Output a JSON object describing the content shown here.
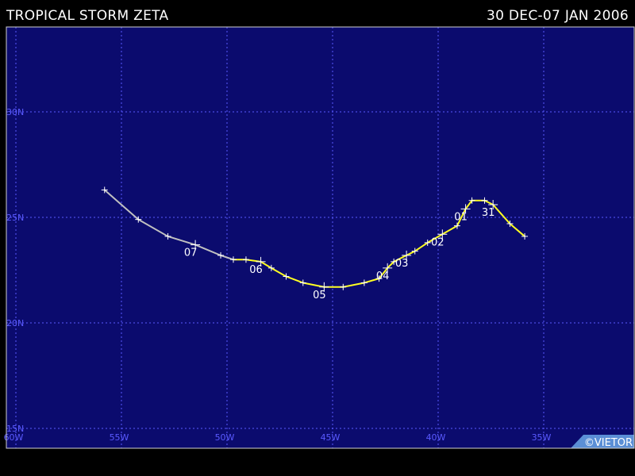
{
  "header": {
    "title": "TROPICAL STORM ZETA",
    "date_range": "30 DEC-07 JAN 2006"
  },
  "credit": "©VIETOR",
  "colors": {
    "ocean": "#0b0b6e",
    "grid": "#5a5aff",
    "axis_label": "#5a5aff",
    "track_storm": "#ffff22",
    "track_depression": "#c0c0c0",
    "marker": "#ffffff",
    "credit_bg": "#5b8fd6"
  },
  "chart_data": {
    "type": "map-track",
    "lon_ticks": [
      {
        "value": -60,
        "label": "60W"
      },
      {
        "value": -55,
        "label": "55W"
      },
      {
        "value": -50,
        "label": "50W"
      },
      {
        "value": -45,
        "label": "45W"
      },
      {
        "value": -40,
        "label": "40W"
      },
      {
        "value": -35,
        "label": "35W"
      }
    ],
    "lat_ticks": [
      {
        "value": 15,
        "label": "15N"
      },
      {
        "value": 20,
        "label": "20N"
      },
      {
        "value": 25,
        "label": "25N"
      },
      {
        "value": 30,
        "label": "30N"
      }
    ],
    "lon_range": [
      -60,
      -30
    ],
    "lat_range": [
      15,
      30
    ],
    "grid": true,
    "track": [
      {
        "lon": -35.9,
        "lat": 24.1,
        "status": "storm"
      },
      {
        "lon": -36.6,
        "lat": 24.7,
        "status": "storm"
      },
      {
        "lon": -37.4,
        "lat": 25.6,
        "status": "storm",
        "label": "31"
      },
      {
        "lon": -37.8,
        "lat": 25.8,
        "status": "storm"
      },
      {
        "lon": -38.4,
        "lat": 25.8,
        "status": "storm"
      },
      {
        "lon": -38.7,
        "lat": 25.4,
        "status": "storm",
        "label": "01"
      },
      {
        "lon": -39.1,
        "lat": 24.6,
        "status": "storm"
      },
      {
        "lon": -39.8,
        "lat": 24.2,
        "status": "storm",
        "label": "02"
      },
      {
        "lon": -40.5,
        "lat": 23.8,
        "status": "storm"
      },
      {
        "lon": -41.1,
        "lat": 23.4,
        "status": "storm"
      },
      {
        "lon": -41.5,
        "lat": 23.2,
        "status": "storm",
        "label": "03"
      },
      {
        "lon": -42.1,
        "lat": 22.9,
        "status": "storm"
      },
      {
        "lon": -42.4,
        "lat": 22.6,
        "status": "storm",
        "label": "04"
      },
      {
        "lon": -42.8,
        "lat": 22.1,
        "status": "storm"
      },
      {
        "lon": -43.5,
        "lat": 21.9,
        "status": "storm"
      },
      {
        "lon": -44.5,
        "lat": 21.7,
        "status": "storm"
      },
      {
        "lon": -45.4,
        "lat": 21.7,
        "status": "storm",
        "label": "05"
      },
      {
        "lon": -46.4,
        "lat": 21.9,
        "status": "storm"
      },
      {
        "lon": -47.2,
        "lat": 22.2,
        "status": "storm"
      },
      {
        "lon": -47.9,
        "lat": 22.6,
        "status": "storm"
      },
      {
        "lon": -48.4,
        "lat": 22.9,
        "status": "storm",
        "label": "06"
      },
      {
        "lon": -49.1,
        "lat": 23.0,
        "status": "storm"
      },
      {
        "lon": -49.7,
        "lat": 23.0,
        "status": "storm"
      },
      {
        "lon": -50.3,
        "lat": 23.2,
        "status": "depression"
      },
      {
        "lon": -51.5,
        "lat": 23.7,
        "status": "depression",
        "label": "07"
      },
      {
        "lon": -52.8,
        "lat": 24.1,
        "status": "depression"
      },
      {
        "lon": -54.2,
        "lat": 24.9,
        "status": "depression"
      },
      {
        "lon": -55.8,
        "lat": 26.3,
        "status": "depression"
      }
    ]
  }
}
